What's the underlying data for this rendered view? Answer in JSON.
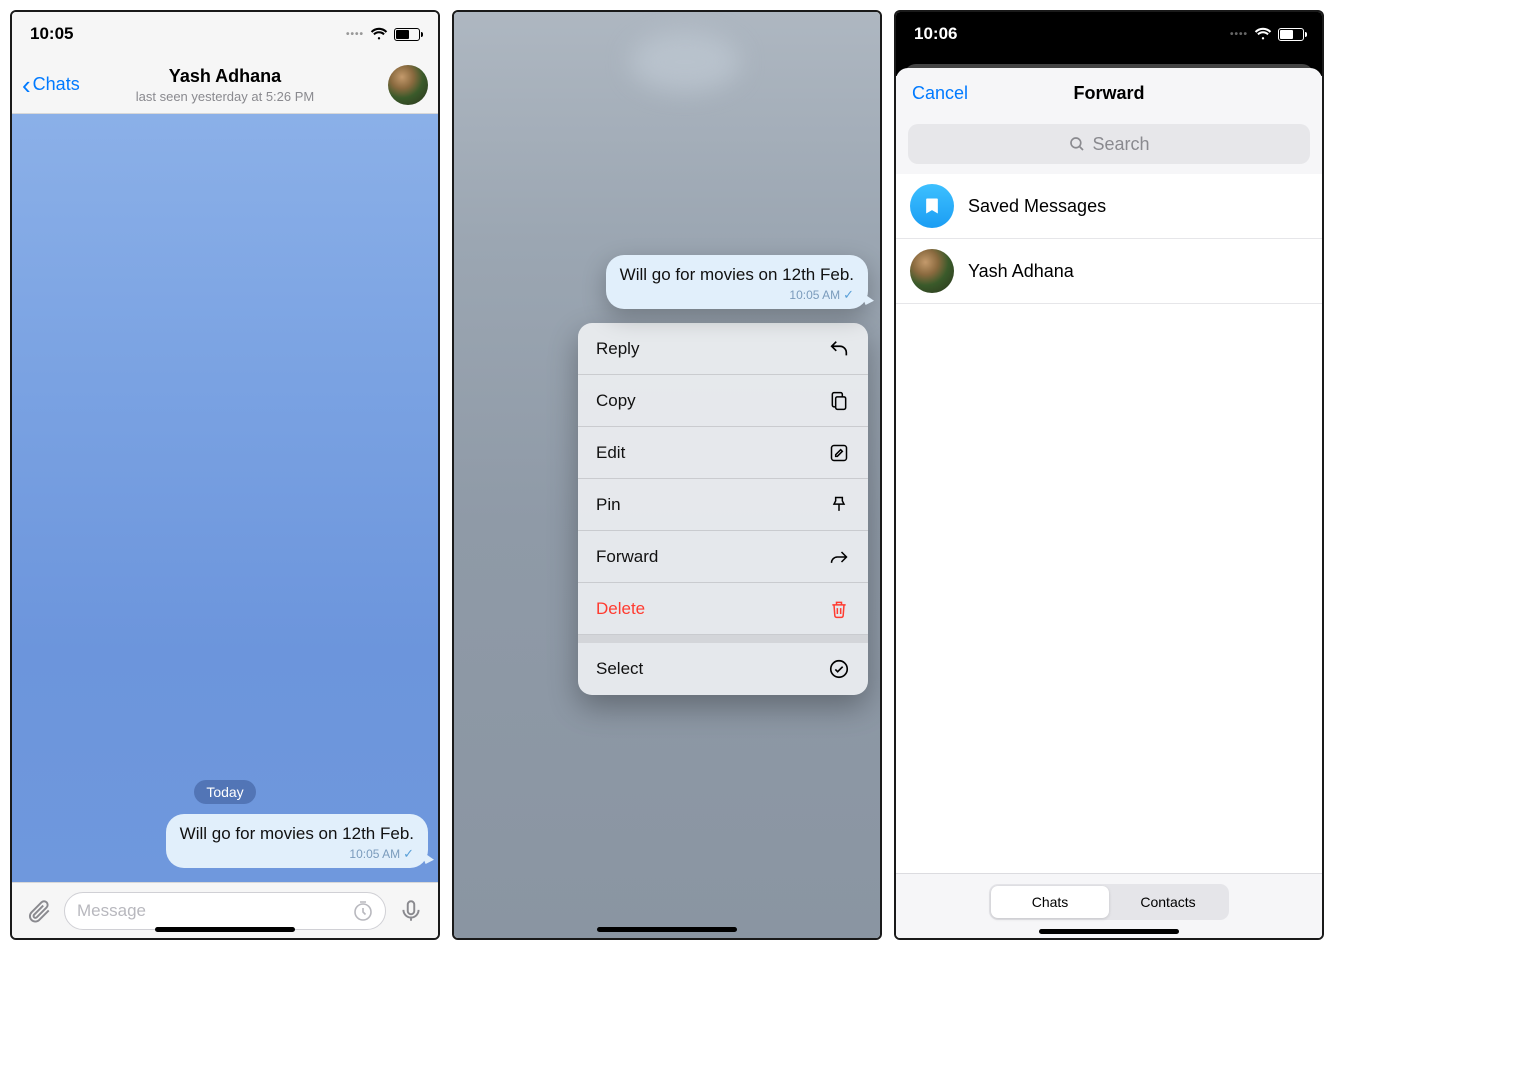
{
  "screen1": {
    "statusTime": "10:05",
    "back": "Chats",
    "title": "Yash Adhana",
    "subtitle": "last seen yesterday at 5:26 PM",
    "dateLabel": "Today",
    "message": "Will go for movies on 12th Feb.",
    "messageTime": "10:05 AM",
    "inputPlaceholder": "Message"
  },
  "screen2": {
    "message": "Will go for movies on 12th Feb.",
    "messageTime": "10:05 AM",
    "menu": {
      "reply": "Reply",
      "copy": "Copy",
      "edit": "Edit",
      "pin": "Pin",
      "forward": "Forward",
      "delete": "Delete",
      "select": "Select"
    }
  },
  "screen3": {
    "statusTime": "10:06",
    "cancel": "Cancel",
    "title": "Forward",
    "searchPlaceholder": "Search",
    "rows": {
      "saved": "Saved Messages",
      "contact1": "Yash Adhana"
    },
    "segments": {
      "chats": "Chats",
      "contacts": "Contacts"
    }
  }
}
